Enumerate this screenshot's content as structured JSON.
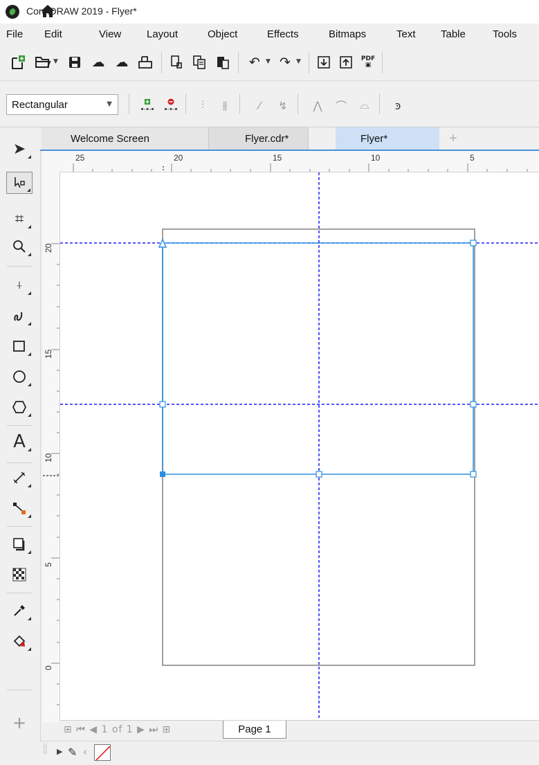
{
  "window": {
    "title": "CorelDRAW 2019 - Flyer*"
  },
  "menu": [
    "File",
    "Edit",
    "View",
    "Layout",
    "Object",
    "Effects",
    "Bitmaps",
    "Text",
    "Table",
    "Tools"
  ],
  "toolbar": {
    "icons": [
      "new-document-icon",
      "open-icon",
      "save-icon",
      "cloud-download-icon",
      "cloud-upload-icon",
      "print-icon",
      "cut-icon",
      "copy-icon",
      "paste-icon",
      "undo-icon",
      "redo-icon",
      "import-icon",
      "export-icon",
      "publish-pdf-icon"
    ],
    "pdf_label": "PDF"
  },
  "property_bar": {
    "mode": "Rectangular",
    "icons": [
      "add-nodes-icon",
      "delete-nodes-icon",
      "join-nodes-icon",
      "break-curve-icon",
      "to-line-icon",
      "to-curve-icon",
      "cusp-node-icon",
      "smooth-node-icon",
      "symmetrical-node-icon",
      "reverse-direction-icon"
    ]
  },
  "tabs": [
    {
      "label": "Welcome Screen"
    },
    {
      "label": "Flyer.cdr*"
    },
    {
      "label": "Flyer*"
    }
  ],
  "ruler": {
    "horizontal": [
      "25",
      "20",
      "15",
      "10",
      "5"
    ],
    "vertical": [
      "20",
      "15",
      "10",
      "5",
      "0"
    ]
  },
  "tools": [
    "pick-tool-icon",
    "shape-tool-icon",
    "crop-tool-icon",
    "zoom-tool-icon",
    "freehand-tool-icon",
    "artistic-media-icon",
    "rectangle-tool-icon",
    "ellipse-tool-icon",
    "polygon-tool-icon",
    "text-tool-icon",
    "parallel-dimension-icon",
    "connector-tool-icon",
    "drop-shadow-icon",
    "transparency-tool-icon",
    "eyedropper-tool-icon",
    "interactive-fill-icon",
    "add-tool-icon"
  ],
  "page_nav": {
    "position": "1 of 1",
    "page_tab": "Page 1"
  },
  "colors": {
    "selection": "#2b8fe0",
    "guideline": "#1a1aff",
    "page_border": "#a0a0a0",
    "active_tab": "#cde0f6"
  }
}
